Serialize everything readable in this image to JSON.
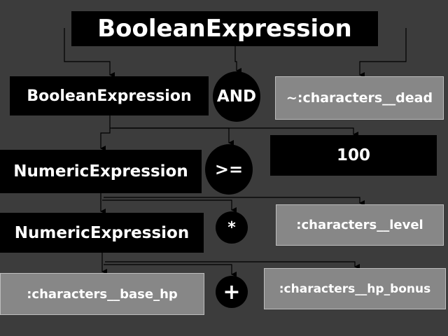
{
  "diagram": {
    "root": "BooleanExpression",
    "left_boolean": "BooleanExpression",
    "and_op": "AND",
    "dead_literal": "~:characters__dead",
    "numeric_1": "NumericExpression",
    "ge_op": ">=",
    "hundred": "100",
    "numeric_2": "NumericExpression",
    "mul_op": "*",
    "level_literal": ":characters__level",
    "base_hp_literal": ":characters__base_hp",
    "plus_op": "+",
    "hp_bonus_literal": ":characters__hp_bonus"
  },
  "colors": {
    "background": "#3c3c3c",
    "expression_node": "#000000",
    "literal_node": "#878787",
    "connector": "#000000",
    "text": "#ffffff"
  }
}
